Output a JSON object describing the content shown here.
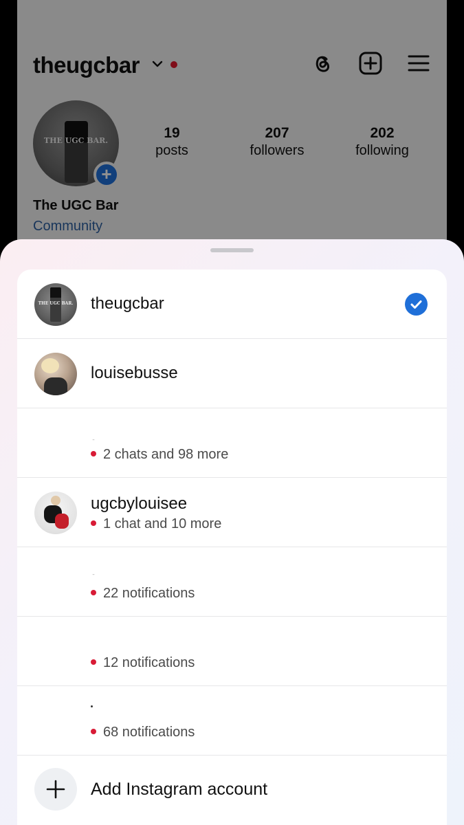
{
  "profile": {
    "username": "theugcbar",
    "avatar_text": "THE UGC BAR.",
    "stats": [
      {
        "count": "19",
        "label": "posts"
      },
      {
        "count": "207",
        "label": "followers"
      },
      {
        "count": "202",
        "label": "following"
      }
    ],
    "display_name": "The UGC Bar",
    "category": "Community"
  },
  "account_switcher": {
    "accounts": [
      {
        "username": "theugcbar",
        "subtitle": "",
        "selected": true,
        "avatar_text": "THE UGC BAR."
      },
      {
        "username": "louisebusse",
        "subtitle": ""
      },
      {
        "username": "",
        "subtitle": "2 chats and 98 more"
      },
      {
        "username": "ugcbylouisee",
        "subtitle": "1 chat and 10 more"
      },
      {
        "username": "",
        "subtitle": "22 notifications"
      },
      {
        "username": "",
        "subtitle": "12 notifications"
      },
      {
        "username": "",
        "subtitle": "68 notifications"
      }
    ],
    "add_account_label": "Add Instagram account"
  },
  "colors": {
    "accent_blue": "#1f6fd8",
    "notification_red": "#d81b36",
    "category_link": "#2d5fa0"
  },
  "icons": [
    "chevron-down-icon",
    "threads-icon",
    "new-post-icon",
    "menu-icon",
    "check-icon",
    "plus-icon"
  ]
}
